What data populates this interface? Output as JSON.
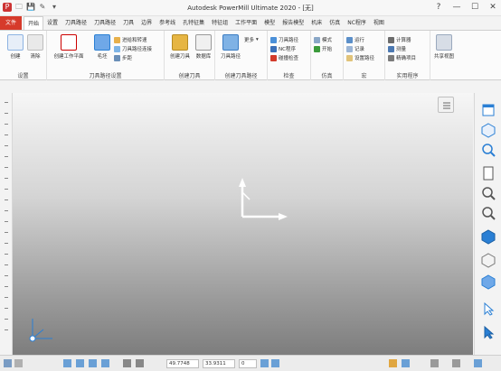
{
  "app": {
    "title": "Autodesk PowerMill Ultimate 2020 - [无]"
  },
  "tabs": [
    {
      "label": "文件"
    },
    {
      "label": "开始"
    },
    {
      "label": "设置"
    },
    {
      "label": "刀具路径"
    },
    {
      "label": "刀具路径"
    },
    {
      "label": "刀具"
    },
    {
      "label": "边界"
    },
    {
      "label": "参考线"
    },
    {
      "label": "孔特征集"
    },
    {
      "label": "特征组"
    },
    {
      "label": "工作平面"
    },
    {
      "label": "模型"
    },
    {
      "label": "报告模型"
    },
    {
      "label": "机床"
    },
    {
      "label": "仿真"
    },
    {
      "label": "NC程序"
    },
    {
      "label": "视图"
    }
  ],
  "ribbon": {
    "setup_group": {
      "label": "设置",
      "create": "创建",
      "clear": "清除"
    },
    "toolpath_setup_group": {
      "label": "刀具路径设置",
      "create_workplane": "创建工作平面",
      "block": "毛坯",
      "rapid_move": "进给和转速",
      "toolpath_connect": "刀具路径连接",
      "feed": "步距"
    },
    "create_tool_group": {
      "label": "创建刀具",
      "tool": "创建刀具",
      "database": "数据库"
    },
    "create_toolpath_group": {
      "label": "创建刀具路径",
      "toolpath": "刀具路径",
      "more": "更多"
    },
    "check_group": {
      "label": "检查",
      "check_toolpath": "刀具路径",
      "nc_program": "NC程序",
      "gouge_check": "碰撞检查"
    },
    "simulate_group": {
      "label": "仿真",
      "mode": "模式",
      "start": "开始"
    },
    "macro_group": {
      "label": "宏",
      "run": "运行",
      "record": "记录",
      "set_path": "设置路径"
    },
    "utility_group": {
      "label": "实用程序",
      "calculator": "计算器",
      "measure": "测量",
      "echo": "精确项目"
    },
    "share": {
      "label": "共享视图"
    }
  },
  "statusbar": {
    "x": "49.7748",
    "y": "33.9311",
    "z": "0"
  },
  "colors": {
    "file_tab": "#d63a2b",
    "accent_blue": "#2a7fd4",
    "viewport_top": "#f6f6f6",
    "viewport_bottom": "#7d7d7d"
  }
}
